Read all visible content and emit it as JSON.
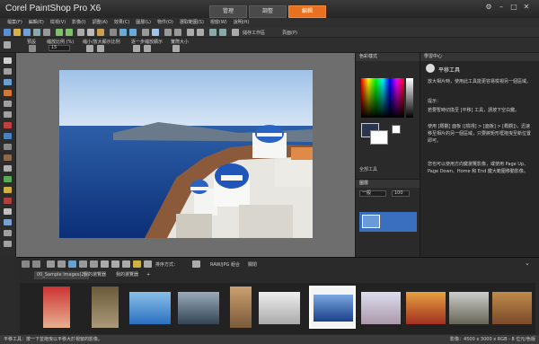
{
  "app": {
    "title": "Corel PaintShop Pro X6"
  },
  "tabs": [
    {
      "label": "管理"
    },
    {
      "label": "調整"
    },
    {
      "label": "編輯"
    }
  ],
  "menus": [
    "檔案(F)",
    "編輯(E)",
    "檢視(V)",
    "影像(I)",
    "調整(A)",
    "效果(C)",
    "圖層(L)",
    "物件(O)",
    "選取範圍(S)",
    "視窗(W)",
    "說明(H)"
  ],
  "toolbar": {
    "save_workspace_label": "儲存工作區",
    "more_label": "頁面(P)",
    "tool_labels": [
      "預設",
      "縮放比例 (%)",
      "縮小/放大顯示比例",
      "逐一步縮放顯示",
      "實際大小"
    ],
    "zoom_value": "15"
  },
  "color_panel": {
    "title": "色彩樣式",
    "all_tools_label": "全部工具"
  },
  "layers_panel": {
    "title": "圖層",
    "mode": "一般",
    "opacity": "100"
  },
  "learning_center": {
    "title": "學習中心",
    "tool_title": "平移工具",
    "intro": "放大相片時，使用此工具能更容易檢視另一個區域。",
    "tips_heading": "提示：",
    "tips": [
      "若要暫時切換至 [平移] 工具，請按下空白鍵。",
      "使用 [概觀] 面板 ([檢視] > [面板] > [概觀])，迅速移至相片的另一個區域，只要將矩形框拖曳至新位置即可。",
      "您也可以使用方向鍵瀏覽影像，或使用 Page Up、Page Down、Home 和 End 鍵大範圍移動影像。"
    ]
  },
  "organizer": {
    "sort_label": "排序方式：",
    "filter_label": "RAW/JPG 組合",
    "filter_value": "關閉",
    "tabs": [
      "00_Sample Images(2)",
      "我的瀏覽器",
      "我的瀏覽器"
    ],
    "add_tab": "+"
  },
  "status": {
    "left": "平移工具：按一下並拖曳以平移大於視窗的影像。",
    "right": "影像：4500 x 3000 x RGB - 8 位元/色版"
  },
  "colors": {
    "accent": "#e8701f",
    "background": "#2b2b2b",
    "canvas": "#6e6e6e"
  }
}
